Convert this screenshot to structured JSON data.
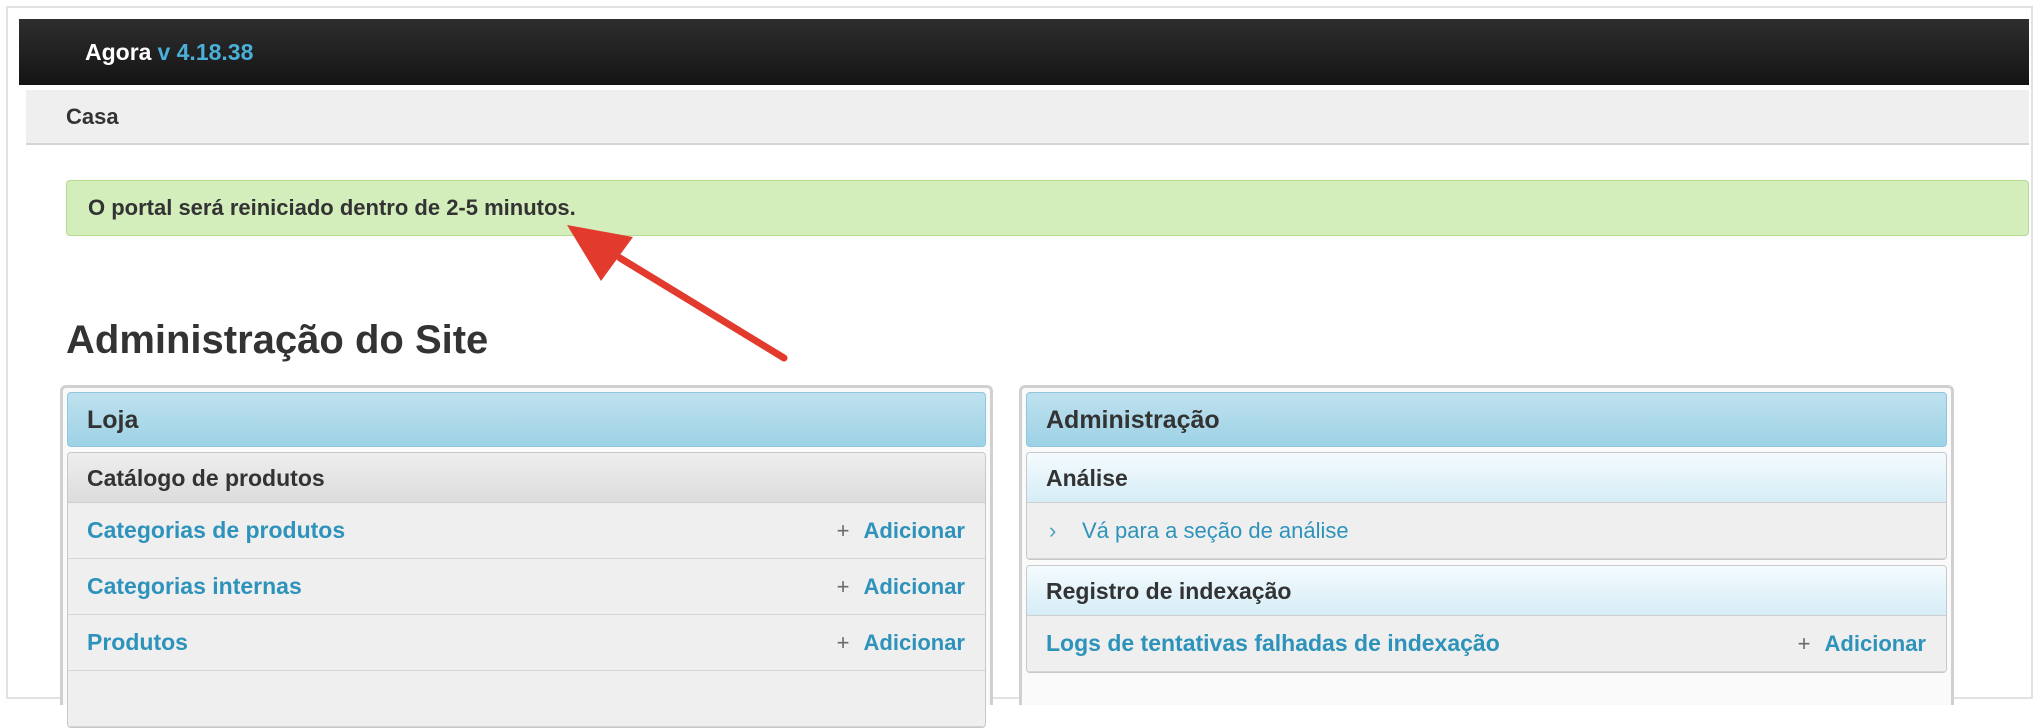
{
  "app": {
    "name": "Agora",
    "version": "v 4.18.38"
  },
  "breadcrumb": {
    "home": "Casa"
  },
  "alert": {
    "message": "O portal será reiniciado dentro de 2-5 minutos."
  },
  "page": {
    "title": "Administração do Site"
  },
  "left_module": {
    "caption": "Loja",
    "group": "Catálogo de produtos",
    "rows": [
      {
        "label": "Categorias de produtos",
        "action": "Adicionar"
      },
      {
        "label": "Categorias internas",
        "action": "Adicionar"
      },
      {
        "label": "Produtos",
        "action": "Adicionar"
      }
    ]
  },
  "right_module": {
    "caption": "Administração",
    "group1": {
      "title": "Análise",
      "link": "Vá para a seção de análise"
    },
    "group2": {
      "title": "Registro de indexação",
      "row": {
        "label": "Logs de tentativas falhadas de indexação",
        "action": "Adicionar"
      }
    }
  },
  "icons": {
    "plus": "plus-icon",
    "chevron": "chevron-right-icon",
    "annotation": "red-arrow"
  },
  "colors": {
    "accent_link": "#2e93bb",
    "alert_bg": "#d3edbb",
    "caption_bg": "#9dd2e6",
    "annotation": "#e23b2e"
  }
}
